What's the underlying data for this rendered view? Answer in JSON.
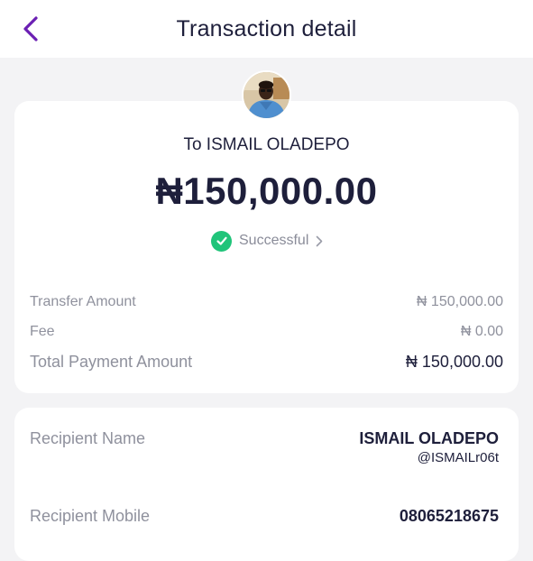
{
  "header": {
    "title": "Transaction detail"
  },
  "summary": {
    "recipient_line": "To ISMAIL OLADEPO",
    "amount": "₦150,000.00",
    "status": "Successful"
  },
  "breakdown": [
    {
      "label": "Transfer Amount",
      "value": "₦ 150,000.00"
    },
    {
      "label": "Fee",
      "value": "₦ 0.00"
    },
    {
      "label": "Total Payment Amount",
      "value": "₦ 150,000.00"
    }
  ],
  "recipient": {
    "name_label": "Recipient Name",
    "name": "ISMAIL OLADEPO",
    "handle": "@ISMAILr06t",
    "mobile_label": "Recipient Mobile",
    "mobile": "08065218675"
  },
  "colors": {
    "accent": "#6b1fb3",
    "success": "#20c47a",
    "text_dark": "#1e1f3b",
    "text_muted": "#8f919d",
    "background": "#f3f3f5"
  },
  "icons": {
    "back": "chevron-left-icon",
    "status": "check-circle-icon",
    "status_more": "chevron-right-icon"
  }
}
